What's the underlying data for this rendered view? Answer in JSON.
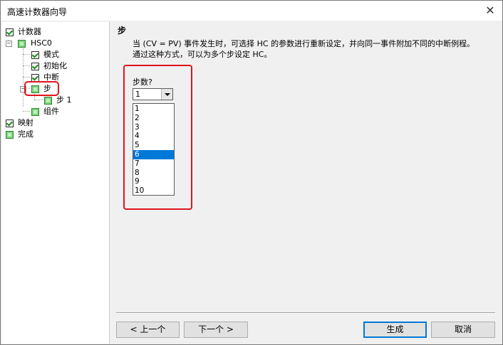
{
  "window": {
    "title": "高速计数器向导",
    "close_glyph": "✕"
  },
  "tree": {
    "items": [
      {
        "label": "计数器",
        "checkbox": "checked"
      },
      {
        "label": "HSC0",
        "checkbox": "green"
      },
      {
        "label": "模式",
        "checkbox": "checked"
      },
      {
        "label": "初始化",
        "checkbox": "checked"
      },
      {
        "label": "中断",
        "checkbox": "checked"
      },
      {
        "label": "步",
        "checkbox": "green"
      },
      {
        "label": "步 1",
        "checkbox": "green"
      },
      {
        "label": "组件",
        "checkbox": "green"
      },
      {
        "label": "映射",
        "checkbox": "checked"
      },
      {
        "label": "完成",
        "checkbox": "green"
      }
    ],
    "expander_minus": "−"
  },
  "panel": {
    "title": "步",
    "description": "当 (CV = PV) 事件发生时，可选择 HC 的参数进行重新设定，并向同一事件附加不同的中断例程。通过这种方式，可以为多个步设定 HC。",
    "field_label": "步数?",
    "combo_value": "1",
    "options": [
      "1",
      "2",
      "3",
      "4",
      "5",
      "6",
      "7",
      "8",
      "9",
      "10"
    ],
    "selected_option": "6"
  },
  "buttons": {
    "prev": "< 上一个",
    "next": "下一个 >",
    "finish": "生成",
    "cancel": "取消"
  },
  "colors": {
    "annotation": "#e0141e",
    "selection": "#0078d7",
    "check": "#1d8a1d",
    "green_box": "#7cd67c"
  }
}
